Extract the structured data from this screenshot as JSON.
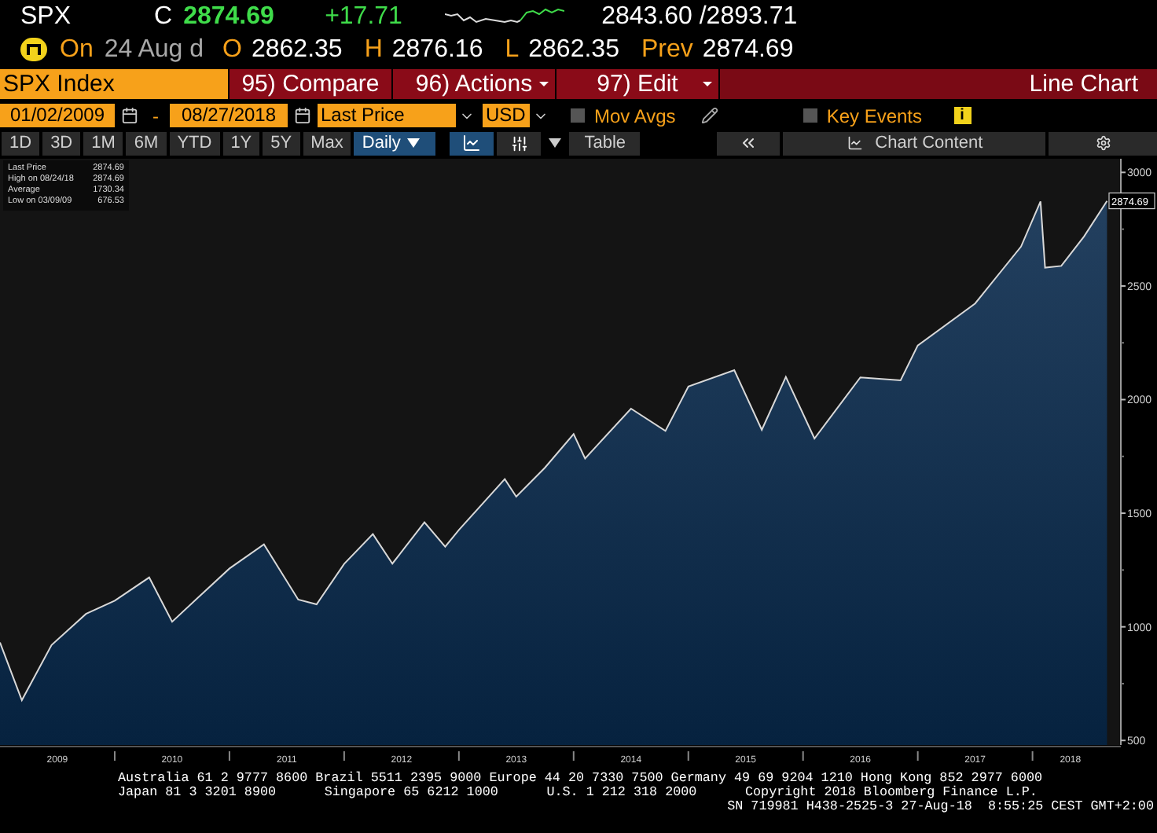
{
  "quote": {
    "ticker": "SPX",
    "close_label": "C",
    "last": "2874.69",
    "change": "+17.71",
    "range": "2843.60 /2893.71"
  },
  "session": {
    "on_label": "On",
    "date": "24 Aug d",
    "fields": [
      {
        "label": "O",
        "value": "2862.35"
      },
      {
        "label": "H",
        "value": "2876.16"
      },
      {
        "label": "L",
        "value": "2862.35"
      },
      {
        "label": "Prev",
        "value": "2874.69"
      }
    ]
  },
  "command_bar": {
    "security": "SPX Index",
    "menus": [
      {
        "label": "95) Compare",
        "dropdown": false
      },
      {
        "label": "96) Actions",
        "dropdown": true
      },
      {
        "label": "97) Edit",
        "dropdown": true
      }
    ],
    "view": "Line Chart"
  },
  "settings": {
    "start_date": "01/02/2009",
    "separator": "-",
    "end_date": "08/27/2018",
    "field": "Last Price",
    "currency": "USD",
    "options": [
      {
        "label": "Mov Avgs",
        "checked": false
      },
      {
        "label": "Key Events",
        "checked": false
      }
    ],
    "info": "i"
  },
  "toolbar": {
    "periods": [
      "1D",
      "3D",
      "1M",
      "6M",
      "YTD",
      "1Y",
      "5Y",
      "Max"
    ],
    "frequency": "Daily",
    "table": "Table",
    "chart_content": "Chart Content"
  },
  "legend": {
    "last_value": "2874.69",
    "stats": [
      {
        "label": "High on 08/24/18",
        "value": "2874.69"
      },
      {
        "label": "Average",
        "value": "1730.34"
      },
      {
        "label": "Low on 03/09/09",
        "value": "676.53"
      }
    ]
  },
  "chart": {
    "last_tag": "2874.69",
    "chart_data": {
      "type": "area",
      "x": [
        2009.0,
        2009.19,
        2009.45,
        2009.75,
        2010.0,
        2010.3,
        2010.5,
        2010.75,
        2011.0,
        2011.3,
        2011.6,
        2011.76,
        2012.0,
        2012.25,
        2012.42,
        2012.7,
        2012.88,
        2013.0,
        2013.4,
        2013.5,
        2013.75,
        2014.0,
        2014.1,
        2014.5,
        2014.8,
        2015.0,
        2015.4,
        2015.64,
        2015.85,
        2016.1,
        2016.5,
        2016.85,
        2017.0,
        2017.5,
        2017.9,
        2018.07,
        2018.11,
        2018.25,
        2018.45,
        2018.65
      ],
      "series": [
        {
          "name": "Last Price",
          "color": "#d8d8d8",
          "values": [
            931,
            677,
            920,
            1057,
            1115,
            1217,
            1022,
            1140,
            1257,
            1363,
            1120,
            1099,
            1277,
            1408,
            1278,
            1460,
            1353,
            1426,
            1650,
            1573,
            1700,
            1848,
            1741,
            1960,
            1862,
            2058,
            2130,
            1867,
            2100,
            1829,
            2098,
            2085,
            2238,
            2423,
            2673,
            2872,
            2581,
            2588,
            2718,
            2874
          ]
        }
      ],
      "xlim": [
        2009.0,
        2018.77
      ],
      "ylim": [
        480,
        3060
      ],
      "xticks": [
        {
          "value": 2009.5,
          "label": "2009"
        },
        {
          "value": 2010.5,
          "label": "2010"
        },
        {
          "value": 2011.5,
          "label": "2011"
        },
        {
          "value": 2012.5,
          "label": "2012"
        },
        {
          "value": 2013.5,
          "label": "2013"
        },
        {
          "value": 2014.5,
          "label": "2014"
        },
        {
          "value": 2015.5,
          "label": "2015"
        },
        {
          "value": 2016.5,
          "label": "2016"
        },
        {
          "value": 2017.5,
          "label": "2017"
        },
        {
          "value": 2018.33,
          "label": "2018"
        }
      ],
      "yticks": [
        500,
        1000,
        1500,
        2000,
        2500,
        3000
      ]
    }
  },
  "footer": {
    "line_1": "Australia 61 2 9777 8600 Brazil 5511 2395 9000 Europe 44 20 7330 7500 Germany 49 69 9204 1210 Hong Kong 852 2977 6000",
    "line_2": [
      "Japan 81 3 3201 8900",
      "Singapore 65 6212 1000",
      "U.S. 1 212 318 2000",
      "Copyright 2018 Bloomberg Finance L.P."
    ],
    "line_3": "SN 719981 H438-2525-3 27-Aug-18  8:55:25 CEST GMT+2:00"
  }
}
